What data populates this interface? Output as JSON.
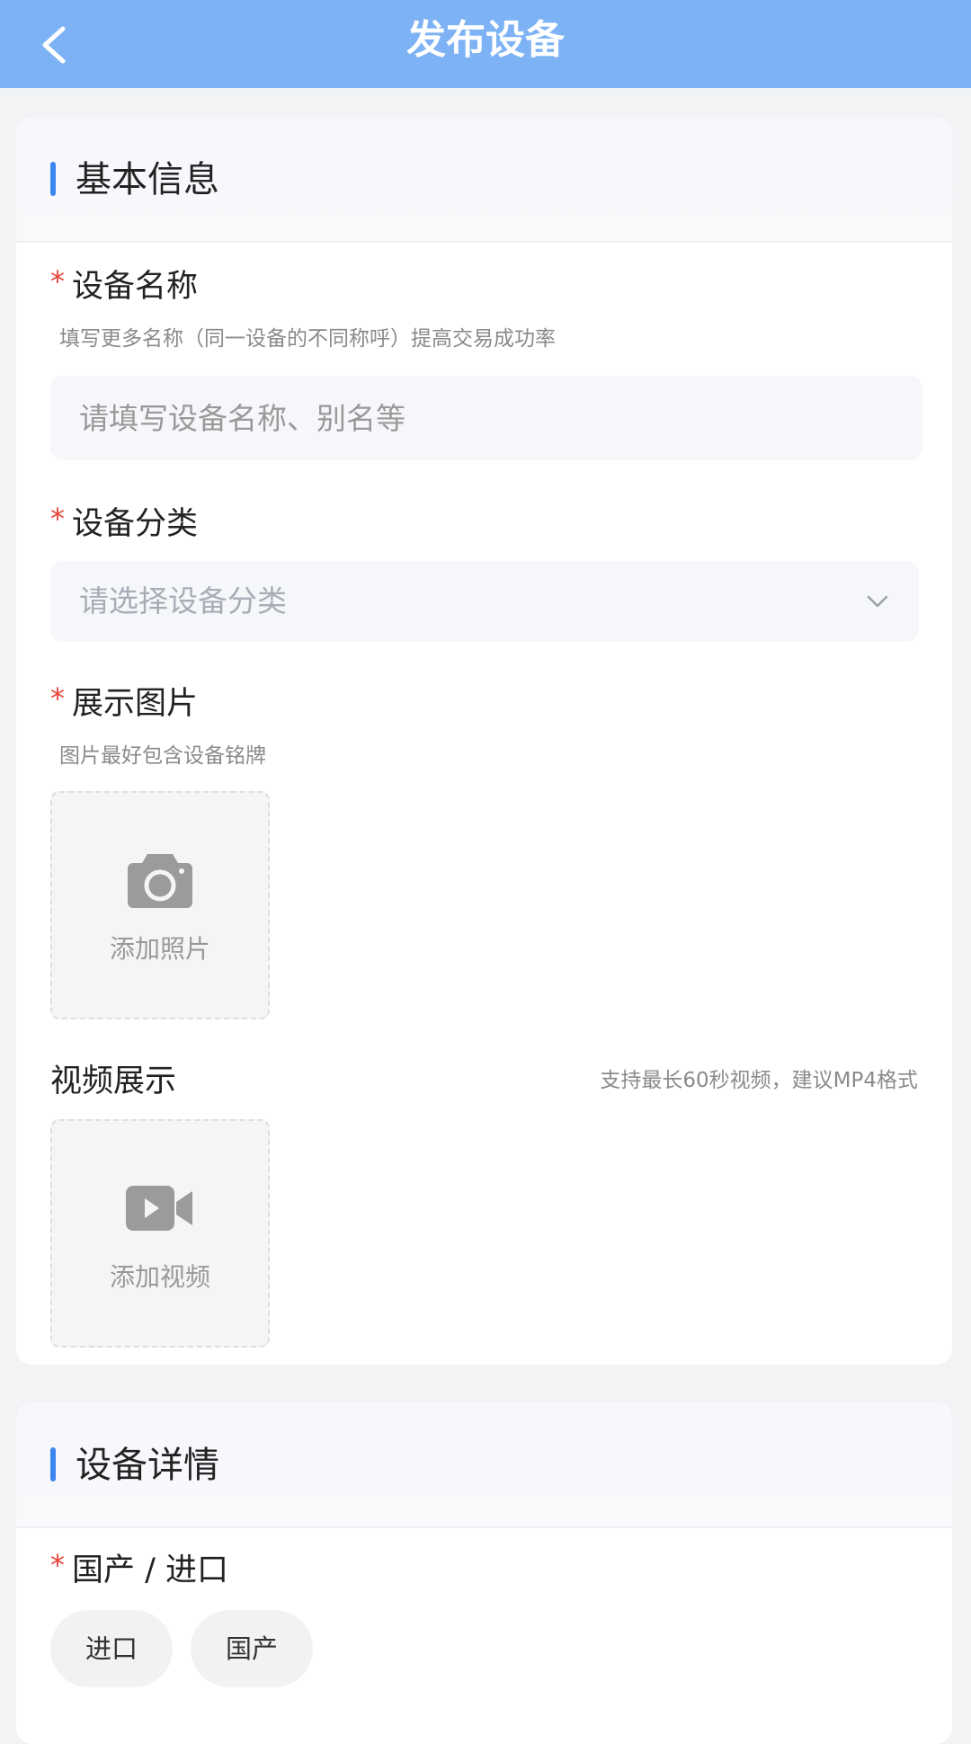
{
  "header": {
    "title": "发布设备",
    "back_icon": "chevron-left-icon"
  },
  "basic_info": {
    "section_title": "基本信息",
    "name_field": {
      "required_mark": "*",
      "label": "设备名称",
      "hint": "填写更多名称（同一设备的不同称呼）提高交易成功率",
      "placeholder": "请填写设备名称、别名等",
      "value": ""
    },
    "category_field": {
      "required_mark": "*",
      "label": "设备分类",
      "placeholder": "请选择设备分类",
      "icon": "chevron-down-icon"
    },
    "images_field": {
      "required_mark": "*",
      "label": "展示图片",
      "hint": "图片最好包含设备铭牌",
      "add_label": "添加照片",
      "icon": "camera-icon"
    },
    "video_field": {
      "label": "视频展示",
      "hint": "支持最长60秒视频，建议MP4格式",
      "add_label": "添加视频",
      "icon": "video-camera-icon"
    }
  },
  "details": {
    "section_title": "设备详情",
    "origin_field": {
      "required_mark": "*",
      "label": "国产 / 进口",
      "options": [
        "进口",
        "国产"
      ]
    }
  },
  "colors": {
    "header_bg": "#7db3f5",
    "accent": "#3d86f0",
    "required": "#e8443a",
    "page_bg": "#f2f3f5"
  }
}
